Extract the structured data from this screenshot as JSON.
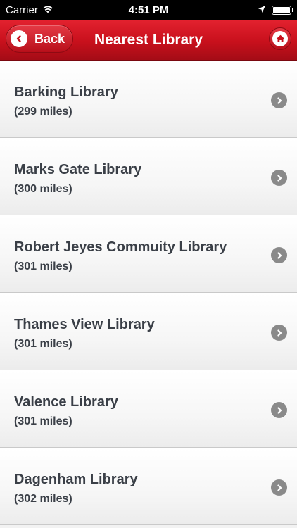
{
  "status_bar": {
    "carrier": "Carrier",
    "time": "4:51 PM"
  },
  "navbar": {
    "back_label": "Back",
    "title": "Nearest Library",
    "color": "#c8101c"
  },
  "libraries": [
    {
      "name": "Barking Library",
      "distance": "(299 miles)"
    },
    {
      "name": "Marks Gate Library",
      "distance": "(300 miles)"
    },
    {
      "name": "Robert Jeyes Commuity Library",
      "distance": "(301 miles)"
    },
    {
      "name": "Thames View Library",
      "distance": "(301 miles)"
    },
    {
      "name": "Valence Library",
      "distance": "(301 miles)"
    },
    {
      "name": "Dagenham Library",
      "distance": "(302 miles)"
    }
  ]
}
